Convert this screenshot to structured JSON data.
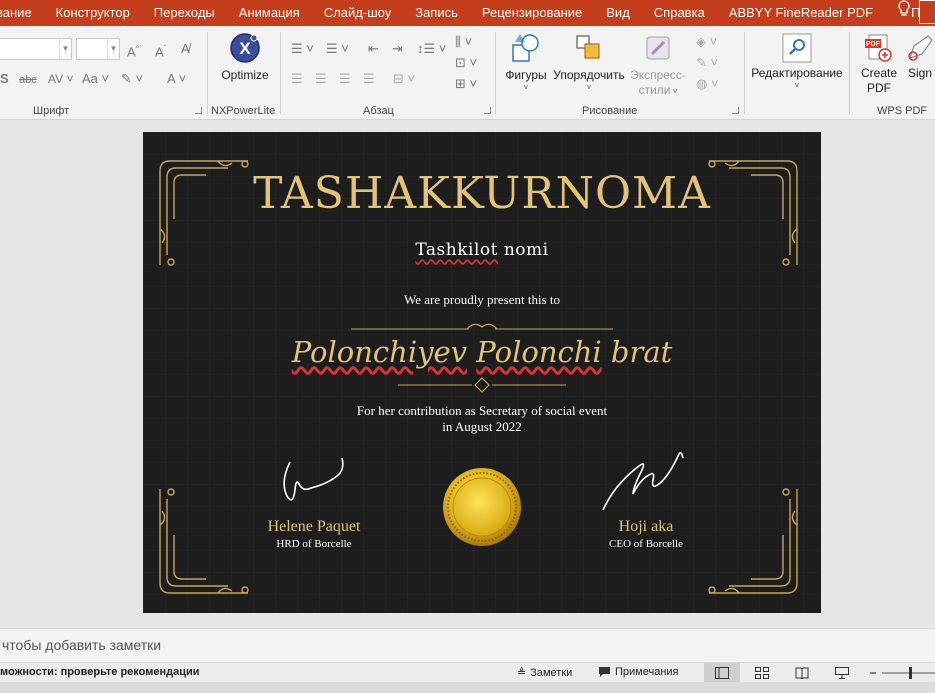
{
  "menu": {
    "items": [
      "вание",
      "Конструктор",
      "Переходы",
      "Анимация",
      "Слайд-шоу",
      "Запись",
      "Рецензирование",
      "Вид",
      "Справка",
      "ABBYY FineReader PDF"
    ],
    "help": "Помощ"
  },
  "ribbon": {
    "groups": {
      "font": "Шрифт",
      "nxpowerlite": "NXPowerLite",
      "paragraph": "Абзац",
      "drawing": "Рисование",
      "wps": "WPS PDF"
    },
    "buttons": {
      "optimize": "Optimize",
      "shapes": "Фигуры",
      "arrange": "Упорядочить",
      "express_styles_1": "Экспресс-",
      "express_styles_2": "стили",
      "editing": "Редактирование",
      "create_pdf_1": "Create",
      "create_pdf_2": "PDF",
      "sign": "Sign"
    }
  },
  "slide": {
    "title": "TASHAKKURNOMA",
    "org_word1": "Tashkilot",
    "org_word2": " nomi",
    "present": "We are proudly present this to",
    "recipient_word1": "Polonchiyev",
    "recipient_word2": " ",
    "recipient_word3": "Polonchi",
    "recipient_word4": " brat",
    "contribution_line1": "For her contribution as Secretary of social event",
    "contribution_line2": "in August 2022",
    "signer_left_name": "Helene Paquet",
    "signer_left_role": "HRD of Borcelle",
    "signer_right_name": "Hoji aka",
    "signer_right_role": "CEO of Borcelle"
  },
  "notes": {
    "placeholder": "чтобы добавить заметки"
  },
  "statusbar": {
    "accessibility": "можности: проверьте рекомендации",
    "notes": "Заметки",
    "comments": "Примечания"
  },
  "colors": {
    "accent": "#c43e1c",
    "gold": "#e3c27a",
    "slide_bg": "#1d1d1d"
  }
}
